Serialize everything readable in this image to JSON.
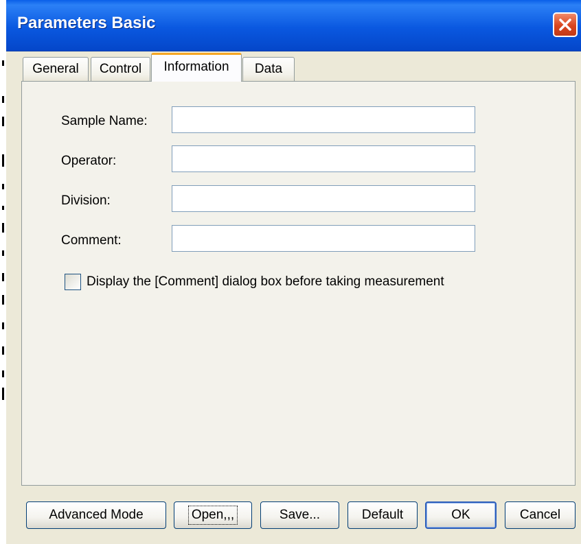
{
  "window": {
    "title": "Parameters  Basic",
    "close_icon": "close-icon"
  },
  "tabs": [
    {
      "label": "General",
      "active": false
    },
    {
      "label": "Control",
      "active": false
    },
    {
      "label": "Information",
      "active": true
    },
    {
      "label": "Data",
      "active": false
    }
  ],
  "information": {
    "sample_name_label": "Sample Name:",
    "sample_name_value": "",
    "operator_label": "Operator:",
    "operator_value": "",
    "division_label": "Division:",
    "division_value": "",
    "comment_label": "Comment:",
    "comment_value": "",
    "display_comment_checkbox_label": "Display the [Comment] dialog box before taking measurement",
    "display_comment_checked": false
  },
  "buttons": {
    "advanced_mode": "Advanced Mode",
    "open": "Open,,,",
    "save": "Save...",
    "default": "Default",
    "ok": "OK",
    "cancel": "Cancel"
  },
  "colors": {
    "titlebar": "#0a58e0",
    "close_button": "#d9451e",
    "dialog_background": "#ece9d8",
    "active_tab_accent": "#f5a623"
  }
}
